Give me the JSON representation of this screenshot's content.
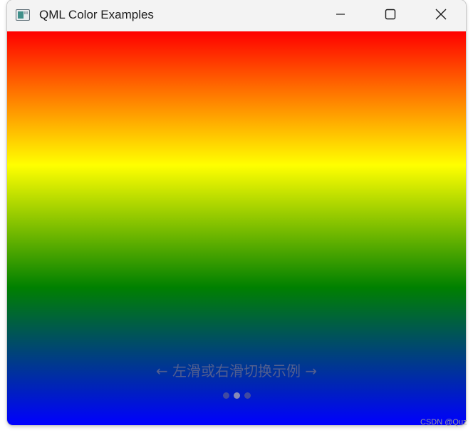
{
  "window": {
    "title": "QML Color Examples"
  },
  "content": {
    "gradient_stops": [
      "#ff0000",
      "#ffff00",
      "#008000",
      "#0000ff"
    ],
    "hint_text": "← 左滑或右滑切换示例 →",
    "page_indicator": {
      "count": 3,
      "current_index": 1
    }
  },
  "watermark": "CSDN @Quz"
}
